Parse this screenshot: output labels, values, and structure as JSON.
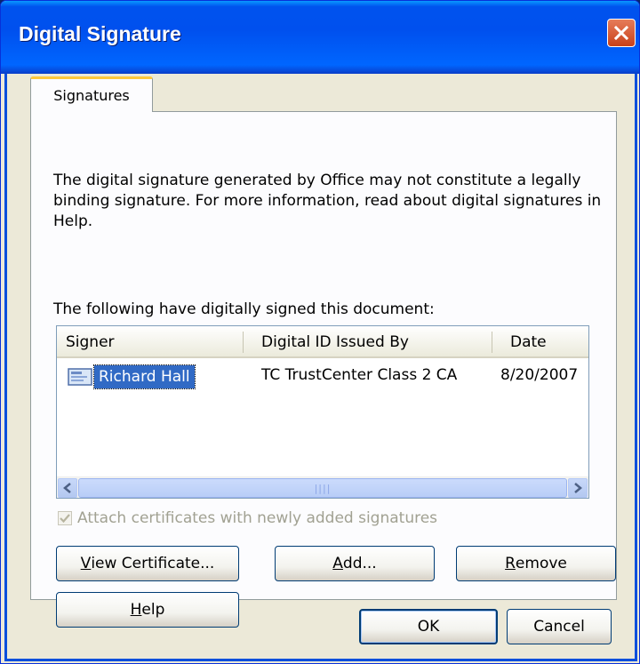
{
  "window": {
    "title": "Digital Signature"
  },
  "tabs": [
    {
      "label": "Signatures"
    }
  ],
  "intro_text": "The digital signature generated by Office may not constitute a legally binding signature. For more information, read about digital signatures in Help.",
  "list_caption": "The following have digitally signed this document:",
  "list": {
    "columns": [
      "Signer",
      "Digital ID Issued By",
      "Date"
    ],
    "rows": [
      {
        "signer": "Richard Hall",
        "issued_by": "TC TrustCenter Class 2 CA",
        "date": "8/20/2007"
      }
    ]
  },
  "attach_certificates": {
    "label": "Attach certificates with newly added signatures",
    "checked": true,
    "disabled": true
  },
  "buttons": {
    "view_certificate": {
      "prefix": "",
      "accel": "V",
      "rest": "iew Certificate..."
    },
    "add": {
      "prefix": "",
      "accel": "A",
      "rest": "dd..."
    },
    "remove": {
      "prefix": "",
      "accel": "R",
      "rest": "emove"
    },
    "help": {
      "prefix": "",
      "accel": "H",
      "rest": "elp"
    },
    "ok": "OK",
    "cancel": "Cancel"
  },
  "colors": {
    "titlebar": "#0053ee",
    "selection": "#316ac5",
    "face": "#ece9d8",
    "tab_highlight": "#ffc83c"
  }
}
